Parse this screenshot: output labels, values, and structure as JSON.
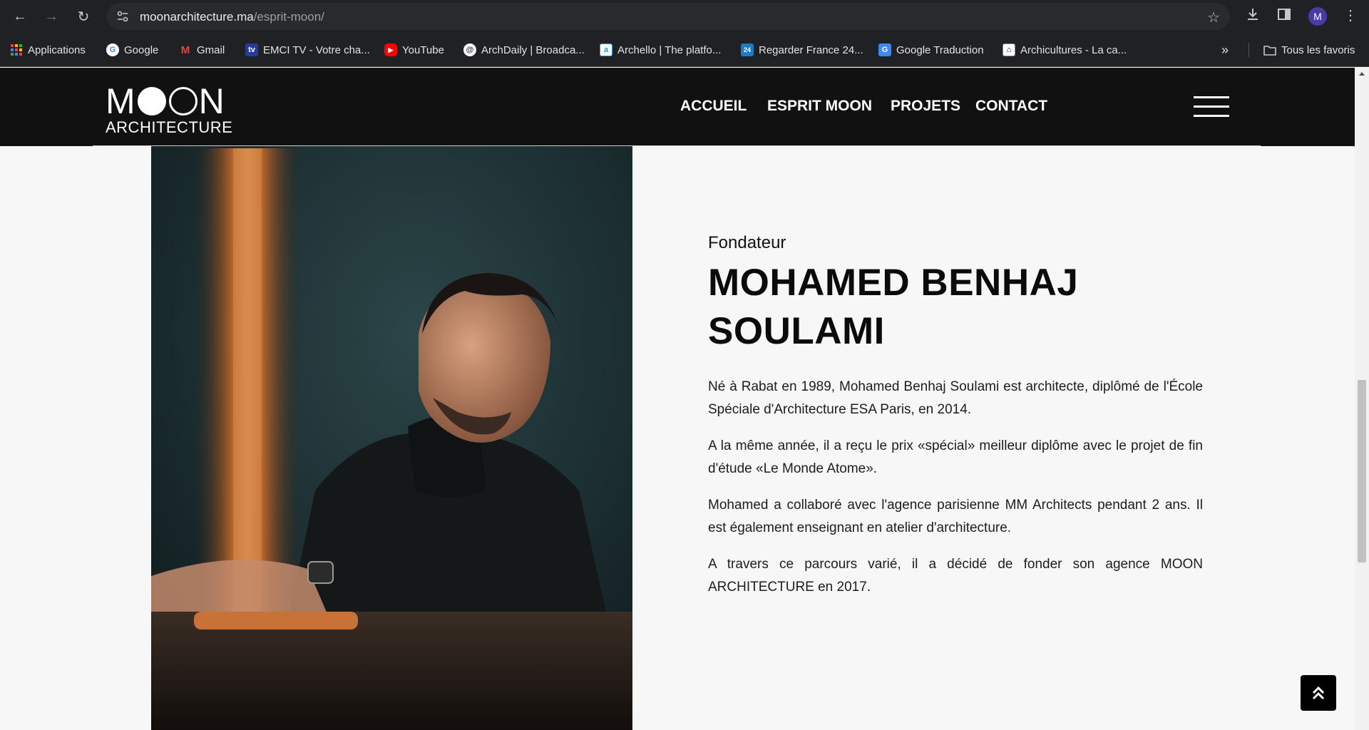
{
  "browser": {
    "url_host": "moonarchitecture.ma",
    "url_path": "/esprit-moon/",
    "profile_initial": "M",
    "bookmarks": [
      {
        "label": "Applications",
        "icon": "apps-grid-icon"
      },
      {
        "label": "Google",
        "icon": "google-icon"
      },
      {
        "label": "Gmail",
        "icon": "gmail-icon"
      },
      {
        "label": "EMCI TV - Votre cha...",
        "icon": "emci-tv-icon"
      },
      {
        "label": "YouTube",
        "icon": "youtube-icon"
      },
      {
        "label": "ArchDaily | Broadca...",
        "icon": "archdaily-icon"
      },
      {
        "label": "Archello | The platfo...",
        "icon": "archello-icon"
      },
      {
        "label": "Regarder France 24...",
        "icon": "france24-icon"
      },
      {
        "label": "Google Traduction",
        "icon": "google-translate-icon"
      },
      {
        "label": "Archicultures - La ca...",
        "icon": "archicultures-icon"
      }
    ],
    "overflow_label": "»",
    "all_bookmarks_label": "Tous les favoris"
  },
  "site": {
    "logo_word": "MOON",
    "logo_sub": "ARCHITECTURE",
    "nav": [
      {
        "label": "ACCUEIL"
      },
      {
        "label": "ESPRIT MOON"
      },
      {
        "label": "PROJETS"
      },
      {
        "label": "CONTACT"
      }
    ]
  },
  "founder": {
    "role": "Fondateur",
    "name_line1": "MOHAMED BENHAJ",
    "name_line2": "SOULAMI",
    "paragraphs": [
      "Né à Rabat en 1989, Mohamed Benhaj Soulami est architecte, diplômé de l'École Spéciale d'Architecture ESA Paris, en 2014.",
      "A la même année, il a reçu le prix «spécial» meilleur diplôme avec le projet de fin d'étude «Le Monde Atome».",
      "Mohamed a collaboré avec l'agence parisienne MM Architects pendant 2 ans. Il est également enseignant en atelier d'architecture.",
      "A travers ce parcours varié, il a décidé de fonder son agence MOON ARCHITECTURE en 2017."
    ]
  },
  "colors": {
    "header_bg": "#111111",
    "page_bg": "#f7f7f7",
    "text": "#0b0b0b"
  }
}
